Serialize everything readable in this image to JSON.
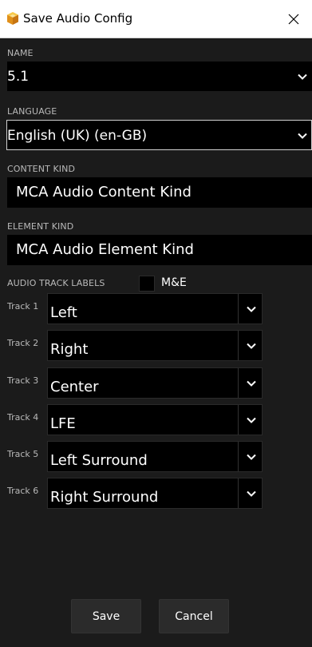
{
  "window": {
    "title": "Save Audio Config",
    "icon": "cube-app-icon",
    "close_icon": "close-icon"
  },
  "name": {
    "label": "NAME",
    "value": "5.1"
  },
  "language": {
    "label": "LANGUAGE",
    "value": "English (UK) (en-GB)"
  },
  "content_kind": {
    "label": "CONTENT KIND",
    "value": "MCA Audio Content Kind"
  },
  "element_kind": {
    "label": "ELEMENT KIND",
    "value": "MCA Audio Element Kind"
  },
  "audio_track_labels": {
    "label": "AUDIO TRACK LABELS",
    "me_label": "M&E",
    "me_checked": false
  },
  "tracks": [
    {
      "label": "Track 1",
      "value": "Left"
    },
    {
      "label": "Track 2",
      "value": "Right"
    },
    {
      "label": "Track 3",
      "value": "Center"
    },
    {
      "label": "Track 4",
      "value": "LFE"
    },
    {
      "label": "Track 5",
      "value": "Left Surround"
    },
    {
      "label": "Track 6",
      "value": "Right Surround"
    }
  ],
  "buttons": {
    "save": "Save",
    "cancel": "Cancel"
  },
  "colors": {
    "background": "#1b1b1b",
    "field": "#000000",
    "label": "#b9b9b9",
    "titlebar": "#ffffff",
    "app_icon": "#f2a81d"
  }
}
